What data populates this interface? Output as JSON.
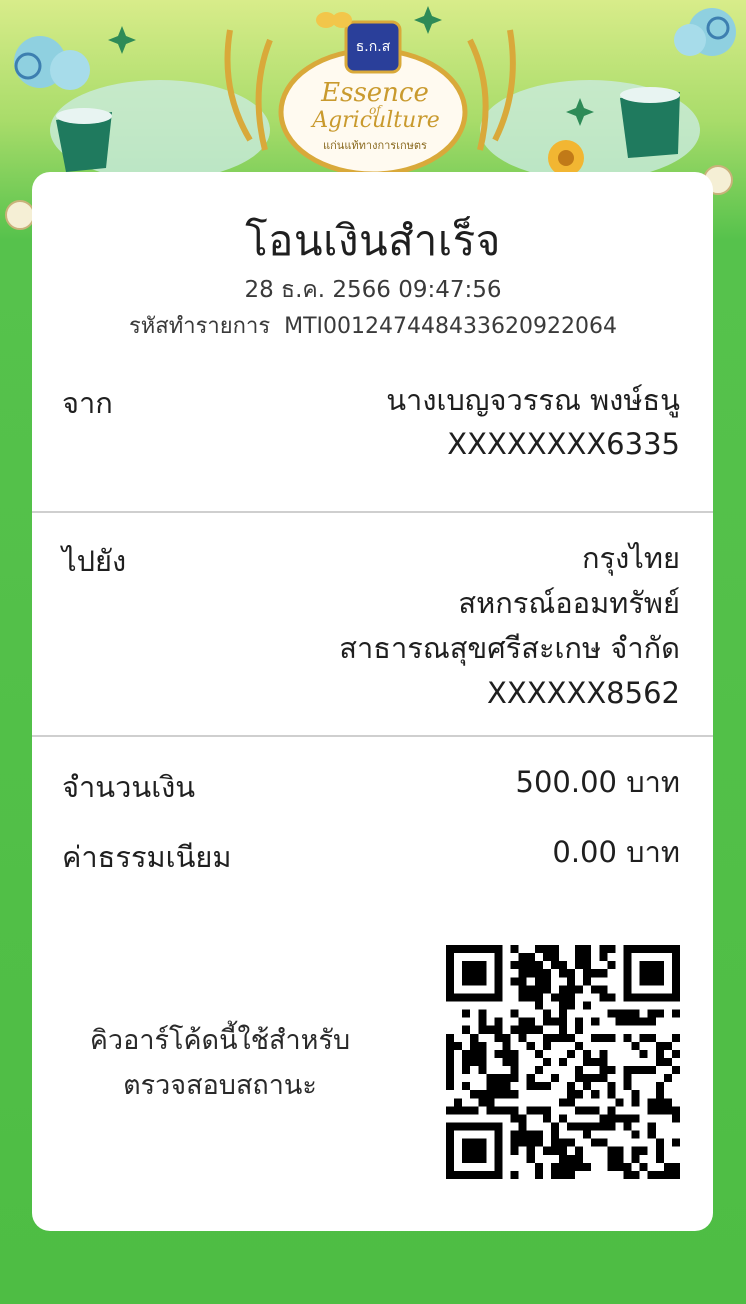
{
  "header": {
    "logo_text": "ธ.ก.ส",
    "banner_line1": "Essence",
    "banner_line2": "of",
    "banner_line3": "Agriculture",
    "banner_sub": "แก่นแท้ทางการเกษตร"
  },
  "receipt": {
    "title": "โอนเงินสำเร็จ",
    "datetime": "28 ธ.ค. 2566 09:47:56",
    "ref_label": "รหัสทำรายการ",
    "ref_value": "MTI001247448433620922064"
  },
  "from": {
    "label": "จาก",
    "name": "นางเบญจวรรณ พงษ์ธนู",
    "account": "XXXXXXXX6335"
  },
  "to": {
    "label": "ไปยัง",
    "bank": "กรุงไทย",
    "name_line1": "สหกรณ์ออมทรัพย์",
    "name_line2": "สาธารณสุขศรีสะเกษ จำกัด",
    "account": "XXXXXX8562"
  },
  "amount": {
    "label": "จำนวนเงิน",
    "value": "500.00 บาท"
  },
  "fee": {
    "label": "ค่าธรรมเนียม",
    "value": "0.00 บาท"
  },
  "qr": {
    "caption_line1": "คิวอาร์โค้ดนี้ใช้สำหรับ",
    "caption_line2": "ตรวจสอบสถานะ"
  },
  "colors": {
    "background_green": "#4ebd44",
    "header_yellow_green": "#d8ec8a",
    "card": "#ffffff",
    "gold": "#d9a93a",
    "logo_blue": "#2a3f9a"
  }
}
